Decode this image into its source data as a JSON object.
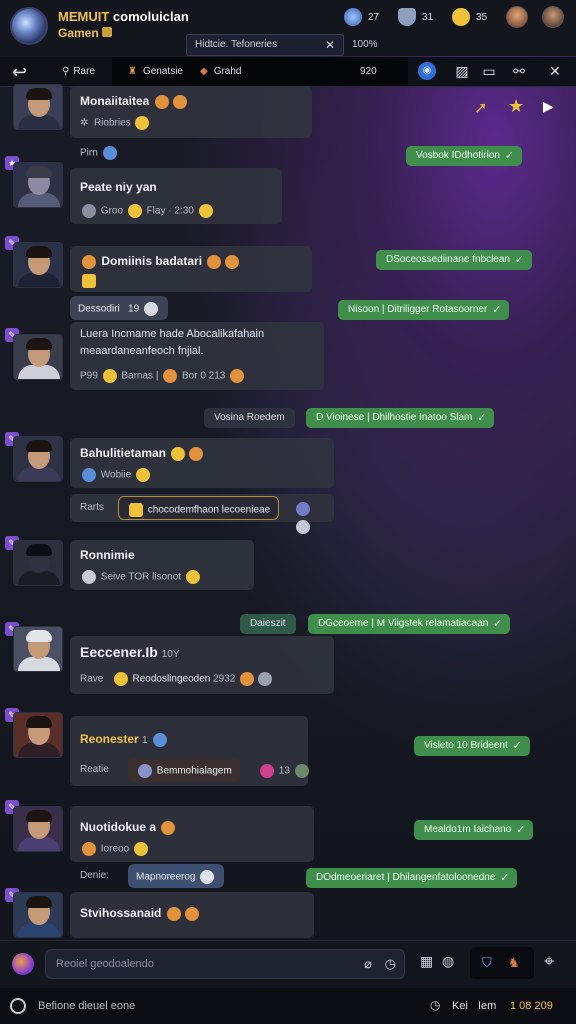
{
  "header": {
    "app_name": "MEMUIT",
    "app_name_rest": "comoluiclan",
    "app_sub": "Gamen",
    "stats": [
      {
        "icon": "globe-icon",
        "value": "27"
      },
      {
        "icon": "shield-icon",
        "value": "31"
      },
      {
        "icon": "smiley-icon",
        "value": "35"
      }
    ],
    "search_value": "Hidtcie. Tefoneries",
    "page_info": "100%"
  },
  "toolbar": {
    "back_icon": "back-arrow-icon",
    "tab1": "Rare",
    "tab2": "Genatsie",
    "tab3": "Grahd",
    "count": "920"
  },
  "messages": [
    {
      "name": "Monaiitaitea",
      "line": "Riobries",
      "status": "Pirn"
    },
    {
      "name": "Peate niy yan",
      "line": "Groo",
      "meta1": "Flay",
      "meta2": "2:30"
    },
    {
      "name": "Domiinis badatari",
      "sub": "Dessodiri",
      "sub_num": "19",
      "text1": "Luera Incmame hade Abocalikafahain",
      "text2": "meaardaneanfeoch fnjial.",
      "line_a": "P99",
      "line_b": "Barnas",
      "line_c": "Bor",
      "line_d": "0 213"
    },
    {
      "name": "Bahulitietaman",
      "line": "Wobiie",
      "label": "Rarts",
      "sub": "chocodemfhaon lecoenieae"
    },
    {
      "name": "Ronnimie",
      "line": "Seive",
      "meta1": "TOR",
      "meta2": "lisonot"
    },
    {
      "name": "Eeccener.Ib",
      "meta": "10Y",
      "label": "Rave",
      "line": "Reodoslingeoden",
      "meta2": "2932"
    },
    {
      "name": "Reonester",
      "meta": "1",
      "label": "Reatie",
      "sub": "Bemmohialagem",
      "meta2": "13"
    },
    {
      "name": "Nuotidokue a",
      "line": "Ioreoo",
      "label": "Denie:",
      "sub": "Mapnoreerog"
    },
    {
      "name": "Stvihossanaid",
      "line": ""
    }
  ],
  "replies": [
    {
      "text": "Vosbok IDdhotirion"
    },
    {
      "text": "DSoceossediinane fnbclean"
    },
    {
      "text": "Nisoon | Ditriligger Rotasoorner"
    },
    {
      "tag": "Vosina Roedem",
      "text": "D Vioinese | Dhilhostie Inatoo Slam"
    },
    {
      "tag": "Daieszit",
      "text": "DGceoeme | M Viigstek relamatiacaan"
    },
    {
      "text": "Visleto 10 Brideent"
    },
    {
      "text": "Mealdo1m Iaichano"
    },
    {
      "text": "DOdmeoeriaret | Dhilangenfatoloonedne"
    }
  ],
  "composer": {
    "placeholder": "Reoiel geodoalendo"
  },
  "statusbar": {
    "left": "Befione dieuel eone",
    "right_label": "Kei",
    "right_val": "Iem",
    "time": "1 08 209"
  },
  "colors": {
    "accent_green": "#3f8e4b",
    "gold": "#f1c24a",
    "tag_purple": "#7d4fd0"
  }
}
